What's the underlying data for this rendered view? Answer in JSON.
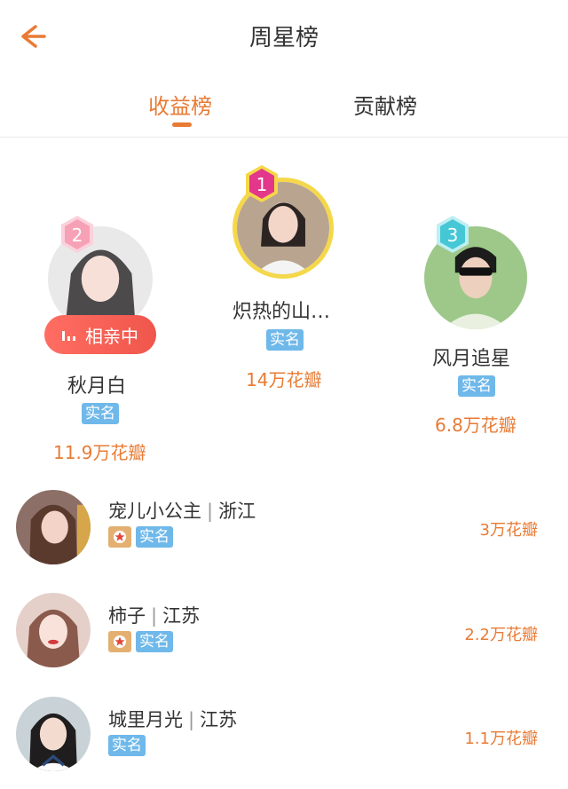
{
  "header": {
    "title": "周星榜",
    "back_icon": "arrow-left-icon"
  },
  "tabs": [
    {
      "label": "收益榜",
      "active": true
    },
    {
      "label": "贡献榜",
      "active": false
    }
  ],
  "podium": [
    {
      "rank": "1",
      "name": "炽热的山…",
      "verified": "实名",
      "score": "14万花瓣"
    },
    {
      "rank": "2",
      "name": "秋月白",
      "verified": "实名",
      "score": "11.9万花瓣",
      "status_button": "相亲中"
    },
    {
      "rank": "3",
      "name": "风月追星",
      "verified": "实名",
      "score": "6.8万花瓣"
    }
  ],
  "list": [
    {
      "name": "宠儿小公主",
      "region": "浙江",
      "vip": true,
      "verified": "实名",
      "score": "3万花瓣"
    },
    {
      "name": "柿子",
      "region": "江苏",
      "vip": true,
      "verified": "实名",
      "score": "2.2万花瓣"
    },
    {
      "name": "城里月光",
      "region": "江苏",
      "vip": false,
      "verified": "实名",
      "score": "1.1万花瓣"
    }
  ],
  "colors": {
    "accent": "#e87b35",
    "verify_badge": "#6fb8ea",
    "rank1": "#e2378a",
    "rank2": "#f7a1b6",
    "rank3": "#45c7d6",
    "gold_ring": "#f5d84a"
  }
}
